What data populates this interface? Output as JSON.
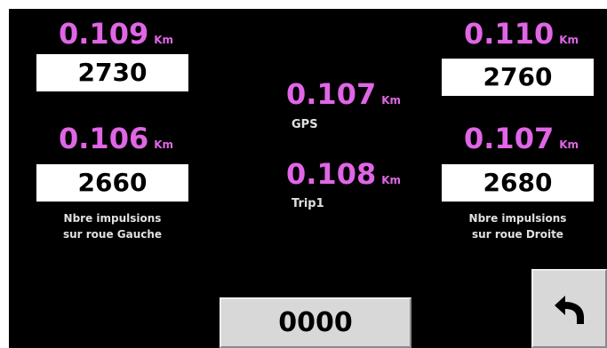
{
  "left": {
    "top_distance": "0.109",
    "top_count": "2730",
    "bottom_distance": "0.106",
    "bottom_count": "2660",
    "caption_line1": "Nbre impulsions",
    "caption_line2": "sur roue Gauche"
  },
  "right": {
    "top_distance": "0.110",
    "top_count": "2760",
    "bottom_distance": "0.107",
    "bottom_count": "2680",
    "caption_line1": "Nbre impulsions",
    "caption_line2": "sur roue Droite"
  },
  "center": {
    "gps_distance": "0.107",
    "gps_label": "GPS",
    "trip_distance": "0.108",
    "trip_label": "Trip1"
  },
  "unit": "Km",
  "bottom_counter": "0000",
  "icons": {
    "back": "back-arrow-icon"
  },
  "colors": {
    "distance": "#e066e6",
    "background": "#000000",
    "button": "#d8d8d8"
  }
}
